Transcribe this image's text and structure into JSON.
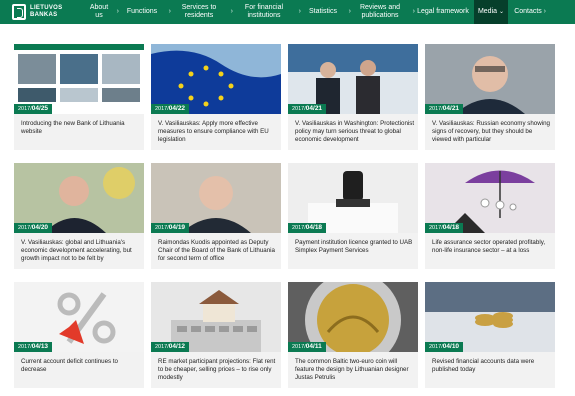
{
  "logo": {
    "line1": "LIETUVOS",
    "line2": "BANKAS"
  },
  "nav": [
    {
      "label": "About us",
      "name": "nav-about"
    },
    {
      "label": "Functions",
      "name": "nav-functions"
    },
    {
      "label": "Services to residents",
      "name": "nav-services"
    },
    {
      "label": "For financial institutions",
      "name": "nav-financial"
    },
    {
      "label": "Statistics",
      "name": "nav-statistics"
    },
    {
      "label": "Reviews and publications",
      "name": "nav-reviews"
    },
    {
      "label": "Legal framework",
      "name": "nav-legal"
    },
    {
      "label": "Media",
      "name": "nav-media"
    },
    {
      "label": "Contacts",
      "name": "nav-contacts"
    }
  ],
  "cards": [
    {
      "year": "2017",
      "date": "04/25",
      "title": "Introducing the new Bank of Lithuania website"
    },
    {
      "year": "2017",
      "date": "04/22",
      "title": "V. Vasiliauskas: Apply more effective measures to ensure compliance with EU legislation"
    },
    {
      "year": "2017",
      "date": "04/21",
      "title": "V. Vasiliauskas in Washington: Protectionist policy may turn serious threat to global economic development"
    },
    {
      "year": "2017",
      "date": "04/21",
      "title": "V. Vasiliauskas: Russian economy showing signs of recovery, but they should be viewed with particular"
    },
    {
      "year": "2017",
      "date": "04/20",
      "title": "V. Vasiliauskas: global and Lithuania's economic development accelerating, but growth impact not to be felt by"
    },
    {
      "year": "2017",
      "date": "04/19",
      "title": "Raimondas Kuodis appointed as Deputy Chair of the Board of the Bank of Lithuania for second term of office"
    },
    {
      "year": "2017",
      "date": "04/18",
      "title": "Payment institution licence granted to UAB Simplex Payment Services"
    },
    {
      "year": "2017",
      "date": "04/18",
      "title": "Life assurance sector operated profitably, non-life insurance sector – at a loss"
    },
    {
      "year": "2017",
      "date": "04/13",
      "title": "Current account deficit continues to decrease"
    },
    {
      "year": "2017",
      "date": "04/12",
      "title": "RE market participant projections: Flat rent to be cheaper, selling prices – to rise only modestly"
    },
    {
      "year": "2017",
      "date": "04/11",
      "title": "The common Baltic two-euro coin will feature the design by Lithuanian designer Justas Petrulis"
    },
    {
      "year": "2017",
      "date": "04/10",
      "title": "Revised financial accounts data were published today"
    }
  ],
  "colors": {
    "brand": "#0b7a52",
    "active_nav": "#063f2b",
    "card_bg": "#f2f2f2"
  }
}
